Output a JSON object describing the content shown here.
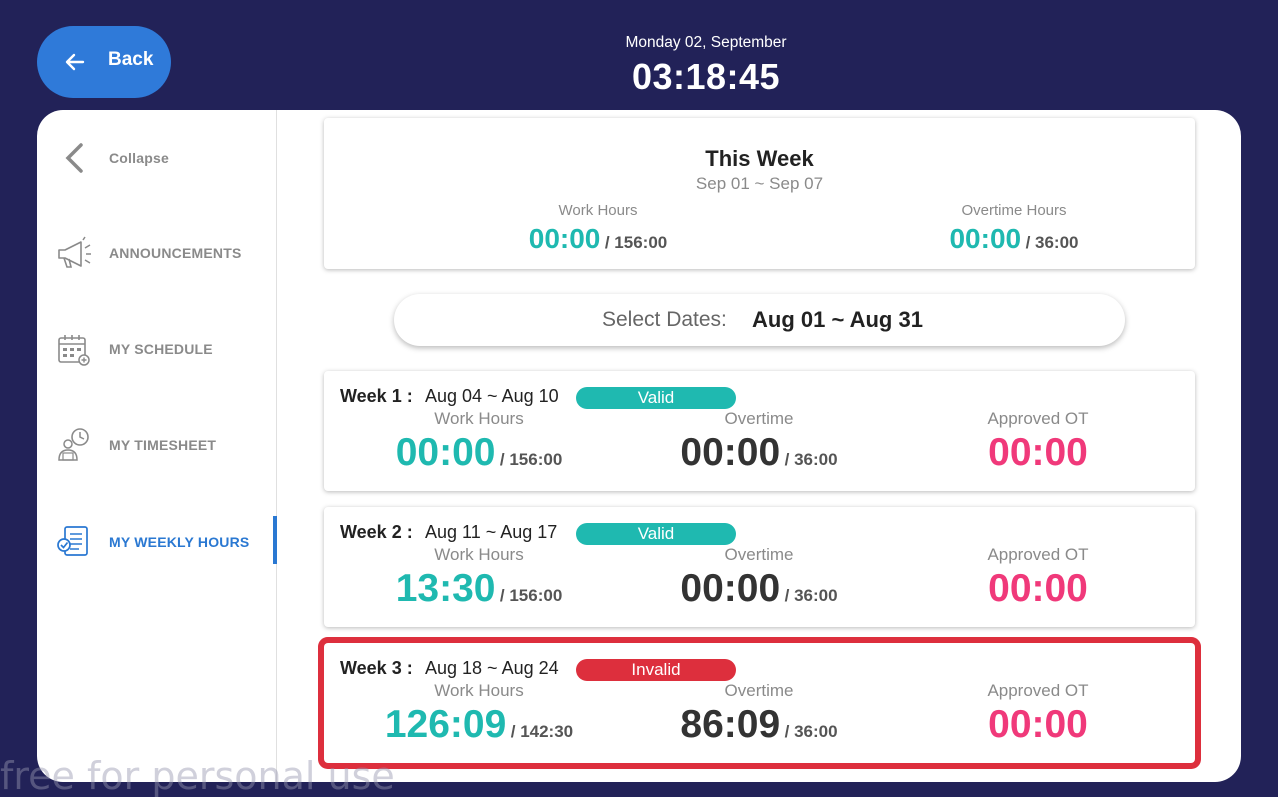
{
  "header": {
    "back_label": "Back",
    "date": "Monday 02, September",
    "time": "03:18:45"
  },
  "sidebar": {
    "items": [
      {
        "label": "Collapse",
        "icon": "chevron-left-icon"
      },
      {
        "label": "ANNOUNCEMENTS",
        "icon": "megaphone-icon"
      },
      {
        "label": "MY SCHEDULE",
        "icon": "calendar-icon"
      },
      {
        "label": "MY TIMESHEET",
        "icon": "timesheet-icon"
      },
      {
        "label": "MY WEEKLY HOURS",
        "icon": "weekly-hours-icon",
        "active": true
      }
    ]
  },
  "this_week": {
    "title": "This Week",
    "range": "Sep 01 ~ Sep 07",
    "work_label": "Work Hours",
    "work_value": "00:00",
    "work_total": "/ 156:00",
    "ot_label": "Overtime Hours",
    "ot_value": "00:00",
    "ot_total": "/ 36:00"
  },
  "date_select": {
    "label": "Select Dates:",
    "value": "Aug 01 ~ Aug 31"
  },
  "weeks": [
    {
      "week": "Week 1 :",
      "range": "Aug 04 ~ Aug 10",
      "status": "Valid",
      "work_label": "Work Hours",
      "work_value": "00:00",
      "work_total": "/ 156:00",
      "ot_label": "Overtime",
      "ot_value": "00:00",
      "ot_total": "/ 36:00",
      "aot_label": "Approved OT",
      "aot_value": "00:00"
    },
    {
      "week": "Week 2 :",
      "range": "Aug 11 ~ Aug 17",
      "status": "Valid",
      "work_label": "Work Hours",
      "work_value": "13:30",
      "work_total": "/ 156:00",
      "ot_label": "Overtime",
      "ot_value": "00:00",
      "ot_total": "/ 36:00",
      "aot_label": "Approved OT",
      "aot_value": "00:00"
    },
    {
      "week": "Week 3 :",
      "range": "Aug 18 ~ Aug 24",
      "status": "Invalid",
      "work_label": "Work Hours",
      "work_value": "126:09",
      "work_total": "/ 142:30",
      "ot_label": "Overtime",
      "ot_value": "86:09",
      "ot_total": "/ 36:00",
      "aot_label": "Approved OT",
      "aot_value": "00:00"
    }
  ],
  "watermark": "free for personal use",
  "colors": {
    "background": "#222258",
    "accent": "#2f7ad9",
    "teal": "#1fb9b0",
    "pink": "#f0397a",
    "invalid": "#dd2f3d"
  }
}
